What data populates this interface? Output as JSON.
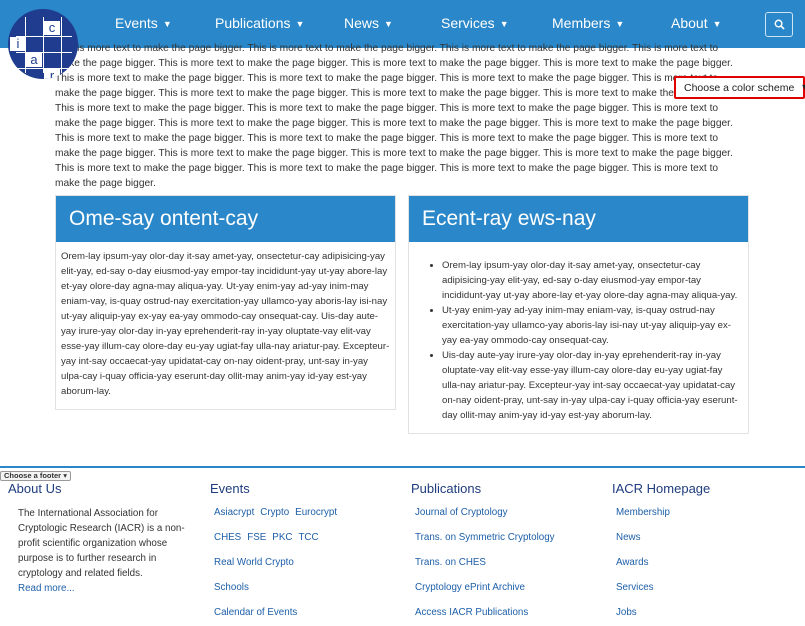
{
  "nav": {
    "items": [
      "Events",
      "Publications",
      "News",
      "Services",
      "Members",
      "About"
    ],
    "logo_letters": [
      "c",
      "i",
      "a",
      "r"
    ]
  },
  "intro_text": "This is more text to make the page bigger. This is more text to make the page bigger. This is more text to make the page bigger. This is more text to make the page bigger. This is more text to make the page bigger. This is more text to make the page bigger. This is more text to make the page bigger. This is more text to make the page bigger. This is more text to make the page bigger. This is more text to make the page bigger. This is more text to make the page bigger. This is more text to make the page bigger. This is more text to make the page bigger. This is more text to make the page bigger. This is more text to make the page bigger. This is more text to make the page bigger. This is more text to make the page bigger. This is more text to make the page bigger. This is more text to make the page bigger. This is more text to make the page bigger. This is more text to make the page bigger. This is more text to make the page bigger. This is more text to make the page bigger. This is more text to make the page bigger. This is more text to make the page bigger. This is more text to make the page bigger. This is more text to make the page bigger. This is more text to make the page bigger. This is more text to make the page bigger. This is more text to make the page bigger. This is more text to make the page bigger. This is more text to make the page bigger.",
  "color_scheme_label": "Choose a color scheme",
  "left_card": {
    "title": "Ome-say ontent-cay",
    "body": "Orem-lay ipsum-yay olor-day it-say amet-yay, onsectetur-cay adipisicing-yay elit-yay, ed-say o-day eiusmod-yay empor-tay incididunt-yay ut-yay abore-lay et-yay olore-day agna-may aliqua-yay. Ut-yay enim-yay ad-yay inim-may eniam-vay, is-quay ostrud-nay exercitation-yay ullamco-yay aboris-lay isi-nay ut-yay aliquip-yay ex-yay ea-yay ommodo-cay onsequat-cay. Uis-day aute-yay irure-yay olor-day in-yay eprehenderit-ray in-yay oluptate-vay elit-vay esse-yay illum-cay olore-day eu-yay ugiat-fay ulla-nay ariatur-pay. Excepteur-yay int-say occaecat-yay upidatat-cay on-nay oident-pray, unt-say in-yay ulpa-cay i-quay officia-yay eserunt-day ollit-may anim-yay id-yay est-yay aborum-lay."
  },
  "right_card": {
    "title": "Ecent-ray ews-nay",
    "items": [
      "Orem-lay ipsum-yay olor-day it-say amet-yay, onsectetur-cay adipisicing-yay elit-yay, ed-say o-day eiusmod-yay empor-tay incididunt-yay ut-yay abore-lay et-yay olore-day agna-may aliqua-yay.",
      "Ut-yay enim-yay ad-yay inim-may eniam-vay, is-quay ostrud-nay exercitation-yay ullamco-yay aboris-lay isi-nay ut-yay aliquip-yay ex-yay ea-yay ommodo-cay onsequat-cay.",
      "Uis-day aute-yay irure-yay olor-day in-yay eprehenderit-ray in-yay oluptate-vay elit-vay esse-yay illum-cay olore-day eu-yay ugiat-fay ulla-nay ariatur-pay. Excepteur-yay int-say occaecat-yay upidatat-cay on-nay oident-pray, unt-say in-yay ulpa-cay i-quay officia-yay eserunt-day ollit-may anim-yay id-yay est-yay aborum-lay."
    ]
  },
  "footer": {
    "selector_label": "Choose a footer",
    "about": {
      "heading": "About Us",
      "text": "The International Association for Cryptologic Research (IACR) is a non-profit scientific organization whose purpose is to further research in cryptology and related fields.",
      "read_more": "Read more..."
    },
    "events": {
      "heading": "Events",
      "conferences_1": [
        "Asiacrypt",
        "Crypto",
        "Eurocrypt"
      ],
      "conferences_2": [
        "CHES",
        "FSE",
        "PKC",
        "TCC"
      ],
      "links": [
        "Real World Crypto",
        "Schools",
        "Calendar of Events"
      ]
    },
    "publications": {
      "heading": "Publications",
      "links": [
        "Journal of Cryptology",
        "Trans. on Symmetric Cryptology",
        "Trans. on CHES",
        "Cryptology ePrint Archive",
        "Access IACR Publications"
      ]
    },
    "homepage": {
      "heading": "IACR Homepage",
      "links": [
        "Membership",
        "News",
        "Awards",
        "Services",
        "Jobs"
      ]
    }
  },
  "colors": {
    "primary": "#2a87c9",
    "logo": "#1f3c8f",
    "link": "#1d5fa8",
    "highlight": "#e00000"
  }
}
